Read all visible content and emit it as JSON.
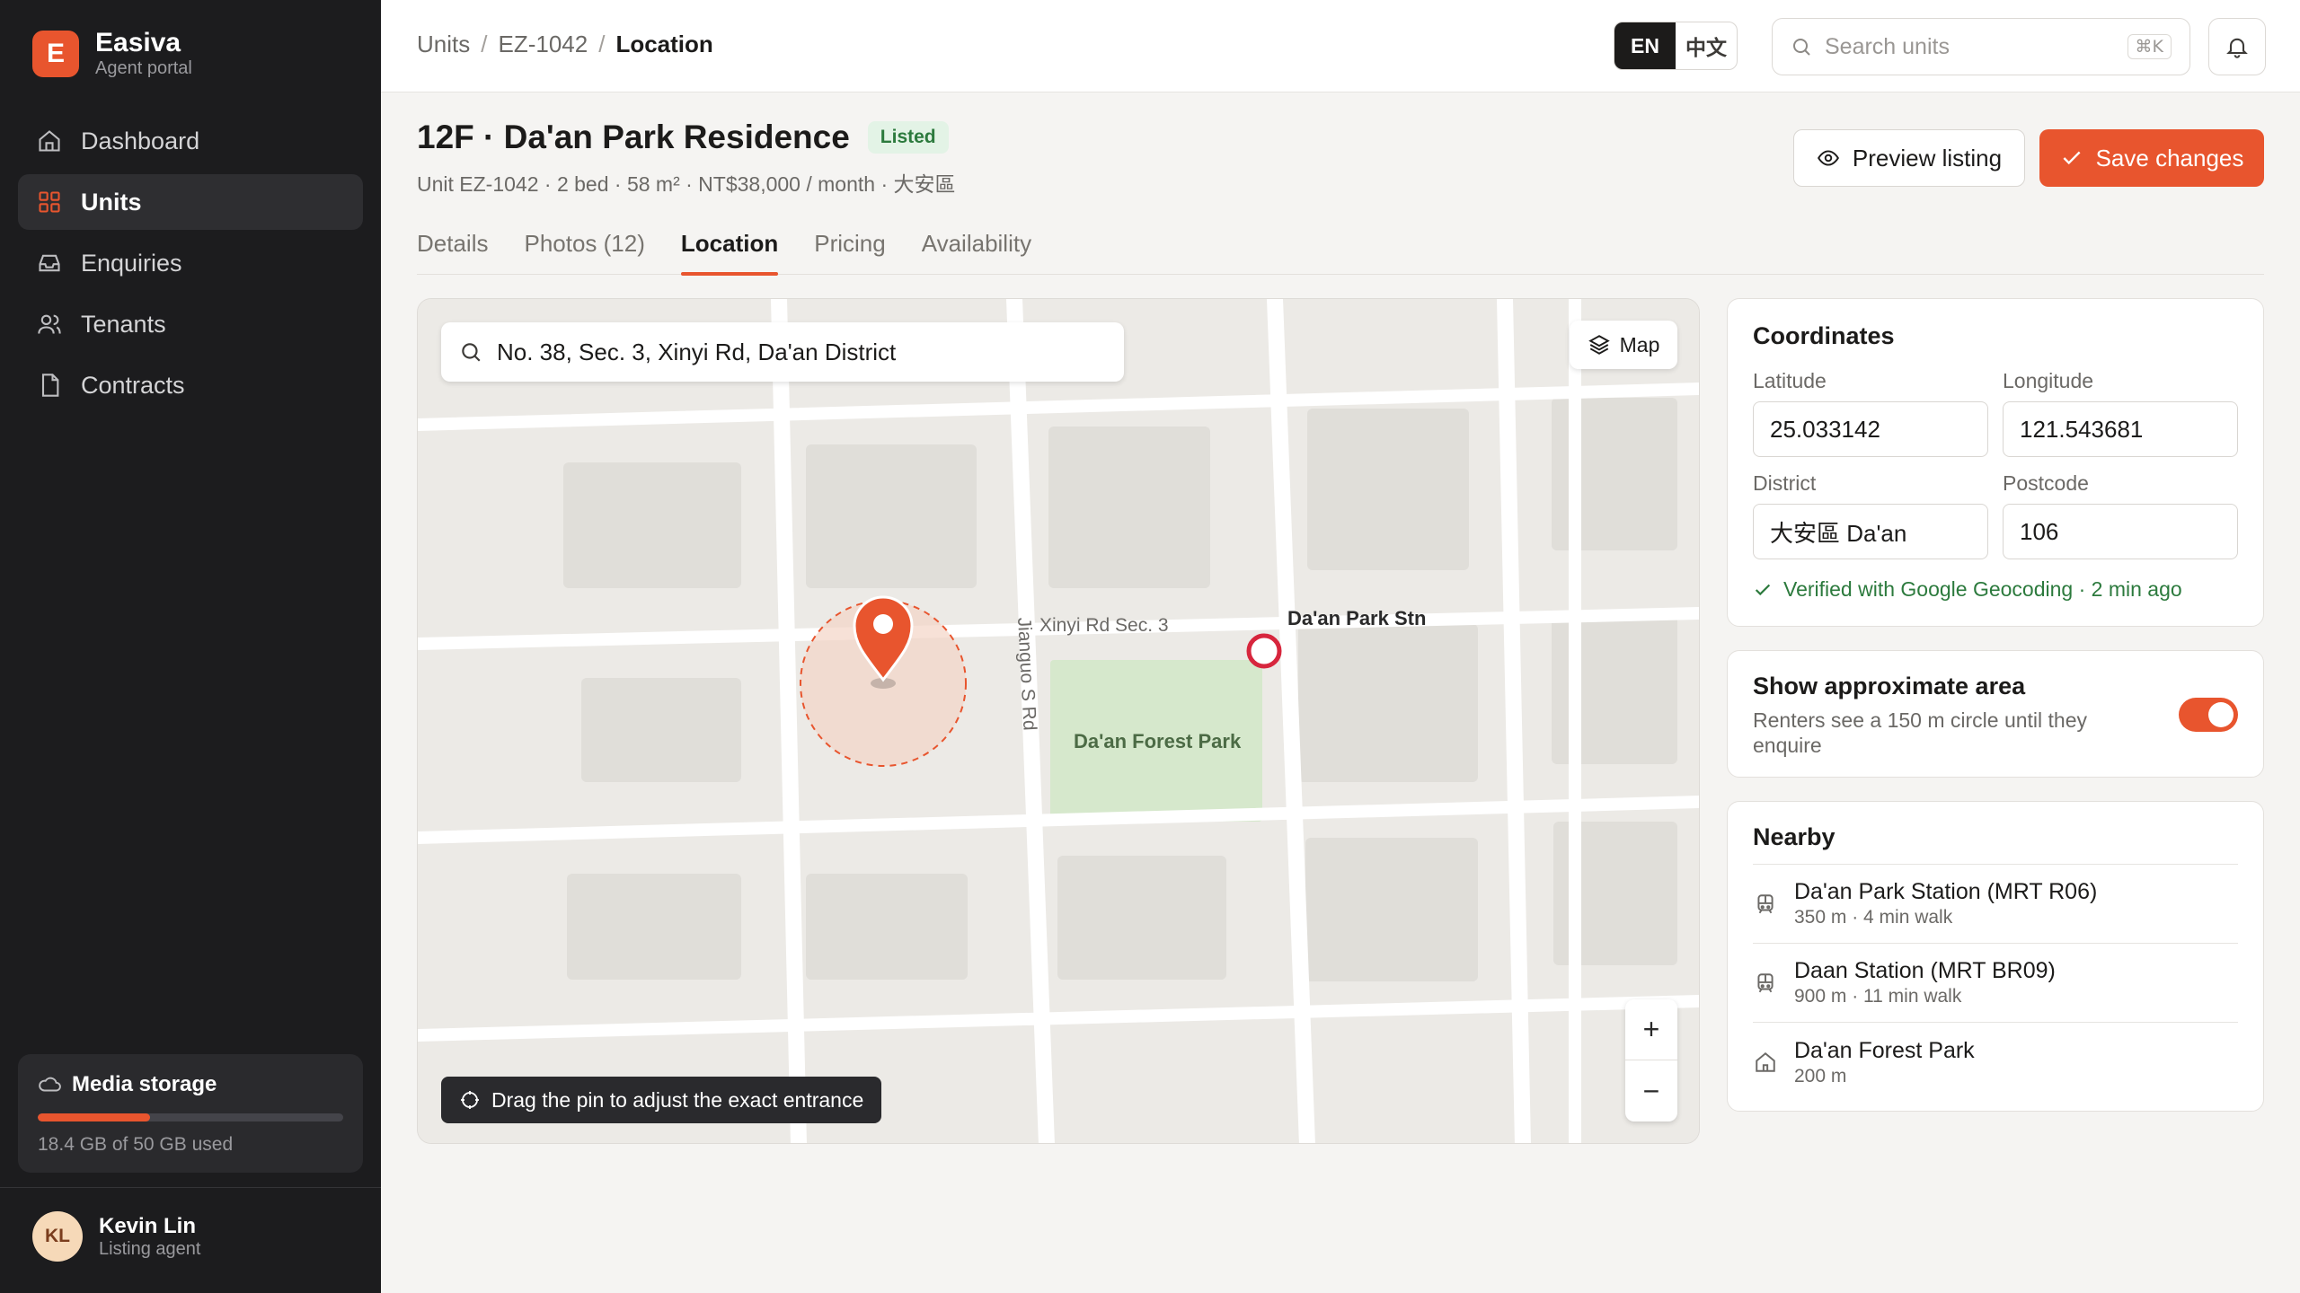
{
  "brand": {
    "name": "Easiva",
    "subtitle": "Agent portal",
    "logo_letter": "E"
  },
  "nav": [
    {
      "label": "Dashboard",
      "icon": "home-icon"
    },
    {
      "label": "Units",
      "icon": "grid-icon",
      "active": true
    },
    {
      "label": "Enquiries",
      "icon": "inbox-icon"
    },
    {
      "label": "Tenants",
      "icon": "users-icon"
    },
    {
      "label": "Contracts",
      "icon": "file-icon"
    }
  ],
  "storage": {
    "title": "Media storage",
    "usage": "18.4 GB of 50 GB used",
    "fraction": 0.368
  },
  "user": {
    "initials": "KL",
    "name": "Kevin Lin",
    "role": "Listing agent"
  },
  "breadcrumb": {
    "root": "Units",
    "unit": "EZ-1042",
    "current": "Location",
    "separator": "/"
  },
  "language": {
    "en": "EN",
    "zh": "中文",
    "selected": "EN"
  },
  "search": {
    "placeholder": "Search units",
    "shortcut": "⌘K"
  },
  "header": {
    "title": "12F · Da'an Park Residence",
    "status": "Listed",
    "subtitle": "Unit EZ-1042 · 2 bed · 58 m² · NT$38,000 / month · 大安區",
    "preview_label": "Preview listing",
    "save_label": "Save changes"
  },
  "tabs": [
    {
      "label": "Details"
    },
    {
      "label": "Photos (12)"
    },
    {
      "label": "Location",
      "active": true
    },
    {
      "label": "Pricing"
    },
    {
      "label": "Availability"
    }
  ],
  "map": {
    "address": "No. 38, Sec. 3, Xinyi Rd, Da'an District",
    "layer_label": "Map",
    "street_h": "Xinyi Rd Sec. 3",
    "street_v": "Jianguo S Rd",
    "park": "Da'an Forest Park",
    "station": "Da'an Park Stn",
    "hint": "Drag the pin to adjust the exact entrance",
    "zoom_in": "+",
    "zoom_out": "−"
  },
  "coordinates": {
    "title": "Coordinates",
    "latitude_label": "Latitude",
    "latitude": "25.033142",
    "longitude_label": "Longitude",
    "longitude": "121.543681",
    "district_label": "District",
    "district": "大安區 Da'an",
    "postcode_label": "Postcode",
    "postcode": "106",
    "verified": "Verified with Google Geocoding · 2 min ago"
  },
  "approx_area": {
    "title": "Show approximate area",
    "description": "Renters see a 150 m circle until they enquire",
    "enabled": true
  },
  "nearby": {
    "title": "Nearby",
    "items": [
      {
        "name": "Da'an Park Station (MRT R06)",
        "meta": "350 m · 4 min walk",
        "icon": "train-icon"
      },
      {
        "name": "Daan Station (MRT BR09)",
        "meta": "900 m · 11 min walk",
        "icon": "train-icon"
      },
      {
        "name": "Da'an Forest Park",
        "meta": "200 m",
        "icon": "park-icon"
      }
    ]
  },
  "colors": {
    "accent": "#e8552e",
    "sidebar": "#1c1c1e",
    "success": "#2c7a3d"
  }
}
